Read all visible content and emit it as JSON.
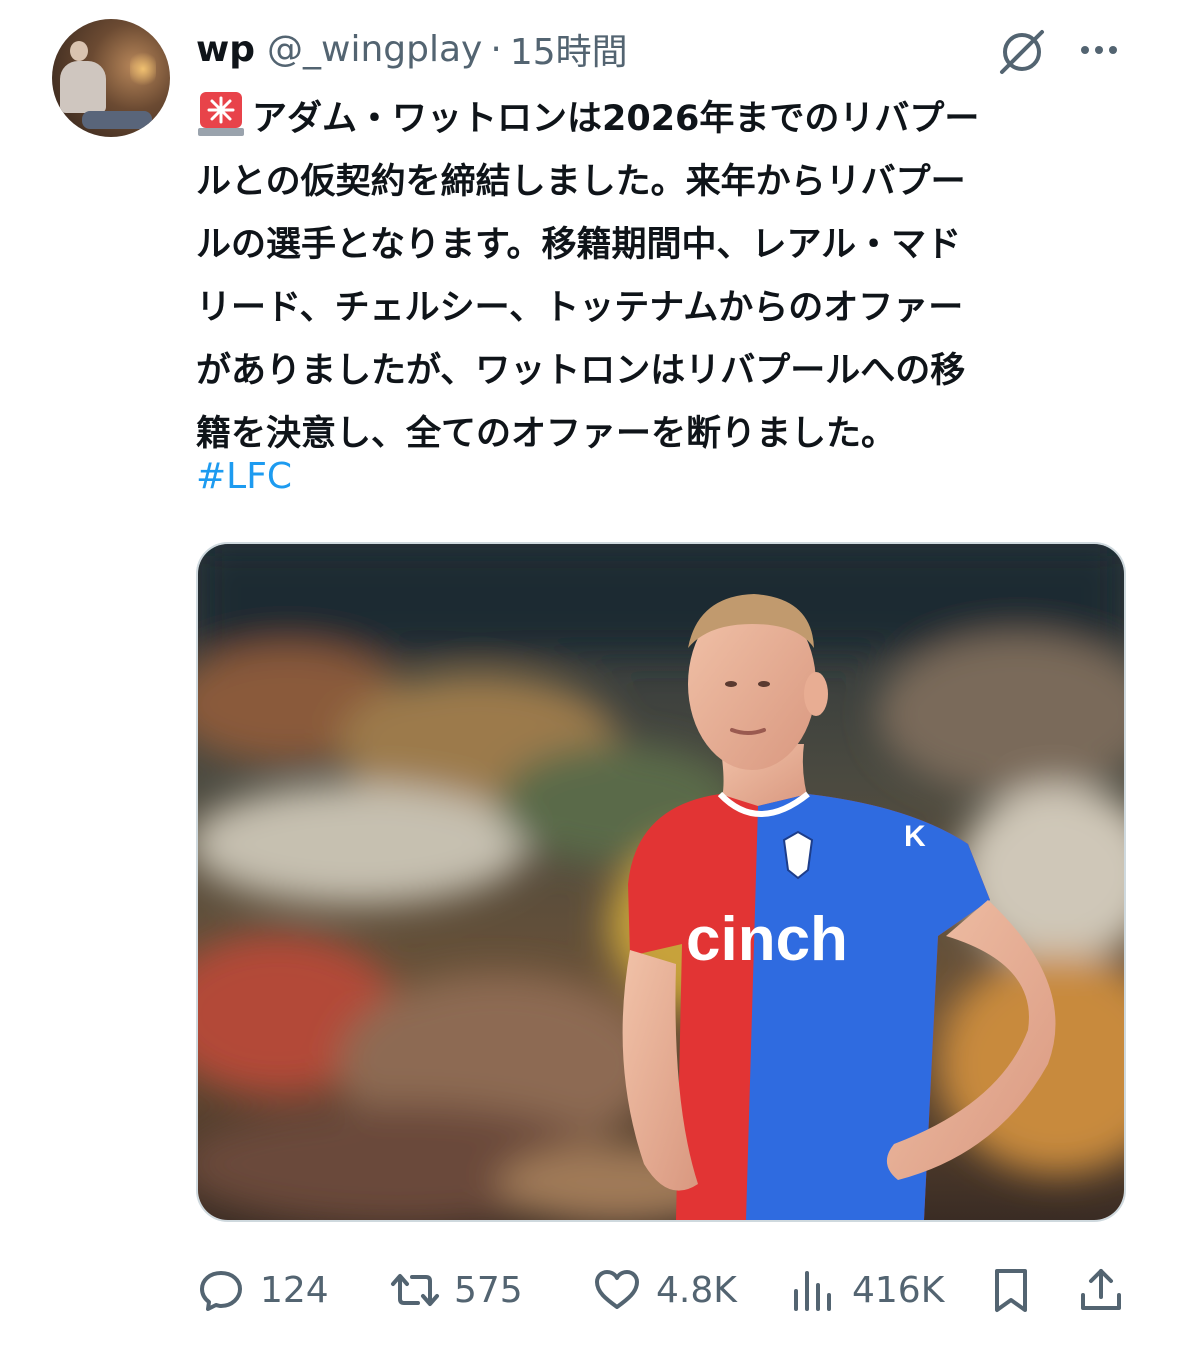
{
  "author": {
    "display_name": "wp",
    "handle": "@_wingplay",
    "separator": "·",
    "time": "15時間"
  },
  "tweet": {
    "emoji_icon": "siren-icon",
    "lines": [
      "アダム・ワットロンは2026年までのリバプー",
      "ルとの仮契約を締結しました。来年からリバプー",
      "ルの選手となります。移籍期間中、レアル・マド",
      "リード、チェルシー、トッテナムからのオファー",
      "がありましたが、ワットロンはリバプールへの移",
      "籍を決意し、全てのオファーを断りました。"
    ],
    "hashtag": "#LFC"
  },
  "media": {
    "shirt_text": "cinch",
    "sponsor_badge": "K"
  },
  "actions": {
    "replies": "124",
    "retweets": "575",
    "likes": "4.8K",
    "views": "416K"
  },
  "colors": {
    "link": "#1d9bf0",
    "muted": "#536471",
    "shirt_red": "#e23434",
    "shirt_blue": "#2f6be0"
  }
}
